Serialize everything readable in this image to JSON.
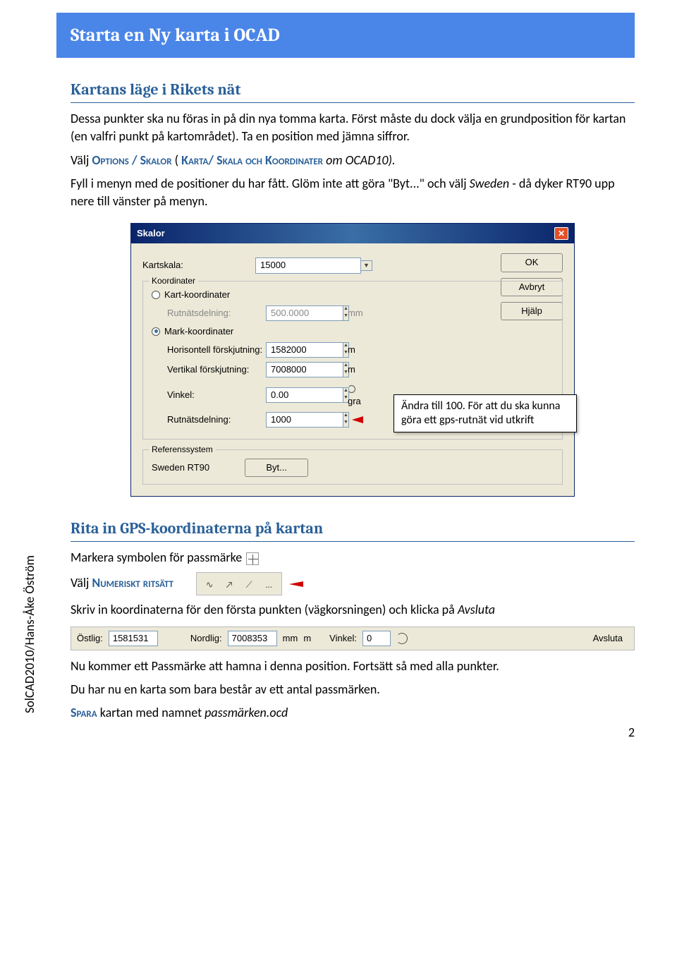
{
  "doc_title": "Starta en Ny karta i OCAD",
  "section1": {
    "heading": "Kartans läge i Rikets nät",
    "p1": "Dessa punkter ska nu föras in på din nya tomma karta. Först måste du dock välja en grundposition för kartan (en valfri punkt på kartområdet). Ta en position med jämna siffror.",
    "p2a": "Välj ",
    "p2b": "Options / Skalor",
    "p2c": "  (",
    "p2d": "Karta/ Skala och Koordinater",
    "p2e": " om OCAD10).",
    "p3a": " Fyll i menyn med de positioner du har fått. Glöm inte att göra \"Byt...\" och välj ",
    "p3b": "Sweden",
    "p3c": " - då dyker RT90 upp nere till vänster på menyn."
  },
  "dialog": {
    "title": "Skalor",
    "kartskala_label": "Kartskala:",
    "kartskala_value": "15000",
    "koordinater_legend": "Koordinater",
    "kart_koord_label": "Kart-koordinater",
    "rutnat_label": "Rutnätsdelning:",
    "rutnat_value_kart": "500.0000",
    "unit_mm": "mm",
    "mark_koord_label": "Mark-koordinater",
    "horis_label": "Horisontell förskjutning:",
    "horis_value": "1582000",
    "vert_label": "Vertikal förskjutning:",
    "vert_value": "7008000",
    "vinkel_label": "Vinkel:",
    "vinkel_value": "0.00",
    "vinkel_unit": "gra",
    "rutnat_value_mark": "1000",
    "unit_m": "m",
    "ref_legend": "Referenssystem",
    "ref_value": "Sweden  RT90",
    "byt_label": "Byt...",
    "ok": "OK",
    "avbryt": "Avbryt",
    "hjalp": "Hjälp"
  },
  "callout": "Ändra till 100. För att du ska kunna göra ett gps-rutnät vid utkrift",
  "section2": {
    "heading": "Rita in GPS-koordinaterna på kartan",
    "p1": "Markera symbolen för passmärke",
    "p2a": "Välj ",
    "p2b": "Numeriskt ritsätt",
    "p3a": " Skriv in koordinaterna för den första punkten (vägkorsningen) och klicka på ",
    "p3b": "Avsluta",
    "p4": "Nu kommer ett Passmärke att hamna i denna position. Fortsätt så med alla punkter.",
    "p5": "Du har nu en karta som bara består av ett antal passmärken.",
    "p6a": "Spara",
    "p6b": " kartan med namnet ",
    "p6c": "passmärken.ocd"
  },
  "coordbar": {
    "ostlig_label": "Östlig:",
    "ostlig_value": "1581531",
    "nordlig_label": "Nordlig:",
    "nordlig_value": "7008353",
    "mm": "mm",
    "m": "m",
    "vinkel_label": "Vinkel:",
    "vinkel_value": "0",
    "avsluta": "Avsluta"
  },
  "sidebar": "SolCAD2010/Hans-Åke Öström",
  "page_number": "2"
}
